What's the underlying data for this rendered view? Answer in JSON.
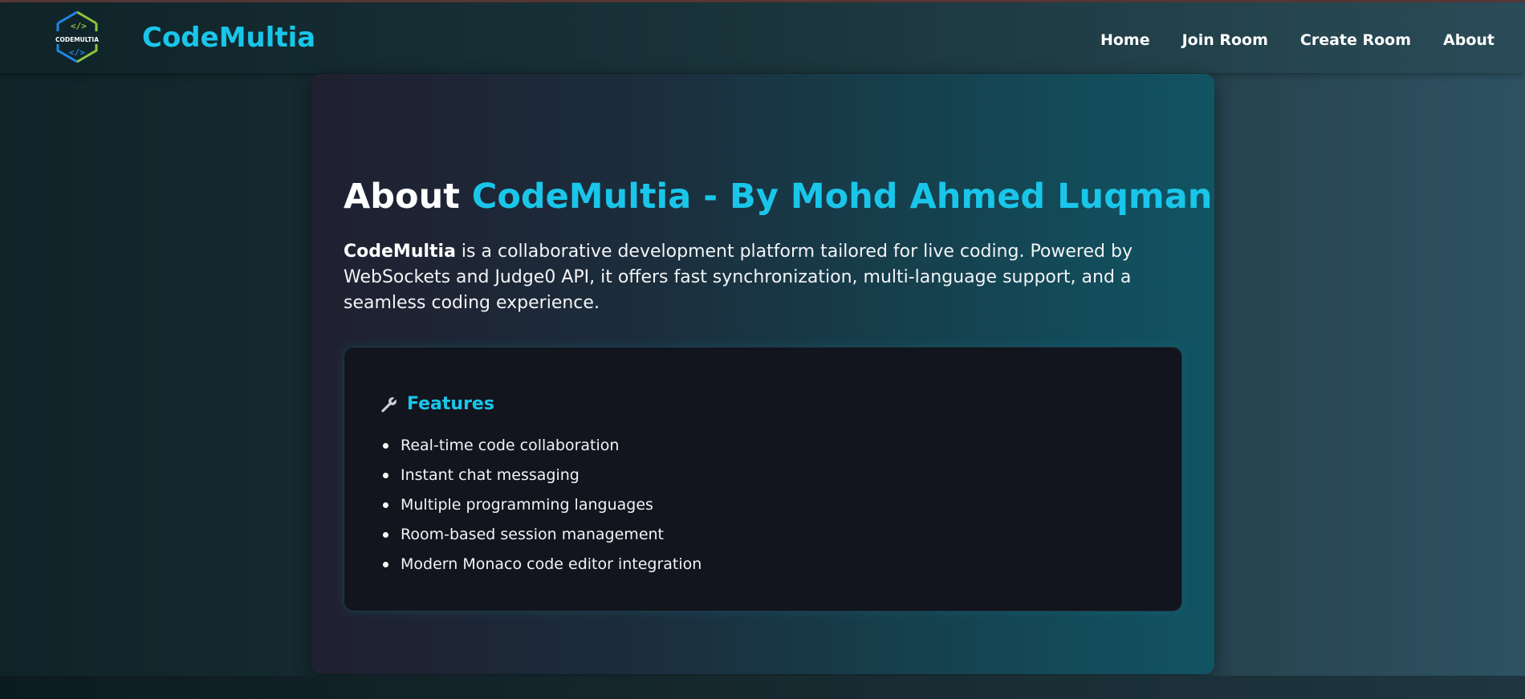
{
  "navbar": {
    "logo_text": "CODEMULTIA",
    "brand": "CodeMultia",
    "links": [
      {
        "label": "Home"
      },
      {
        "label": "Join Room"
      },
      {
        "label": "Create Room"
      },
      {
        "label": "About"
      }
    ]
  },
  "about": {
    "title_prefix": "About",
    "title_accent": "CodeMultia - By Mohd Ahmed Luqman",
    "desc_bold": "CodeMultia",
    "desc_rest": " is a collaborative development platform tailored for live coding. Powered by WebSockets and Judge0 API, it offers fast synchronization, multi-language support, and a seamless coding experience."
  },
  "features": {
    "icon": "wrench-icon",
    "title": "Features",
    "items": [
      "Real-time code collaboration",
      "Instant chat messaging",
      "Multiple programming languages",
      "Room-based session management",
      "Modern Monaco code editor integration"
    ]
  },
  "colors": {
    "accent": "#19c6ea",
    "logo_green": "#8dc63f",
    "logo_blue": "#1e88e5"
  }
}
